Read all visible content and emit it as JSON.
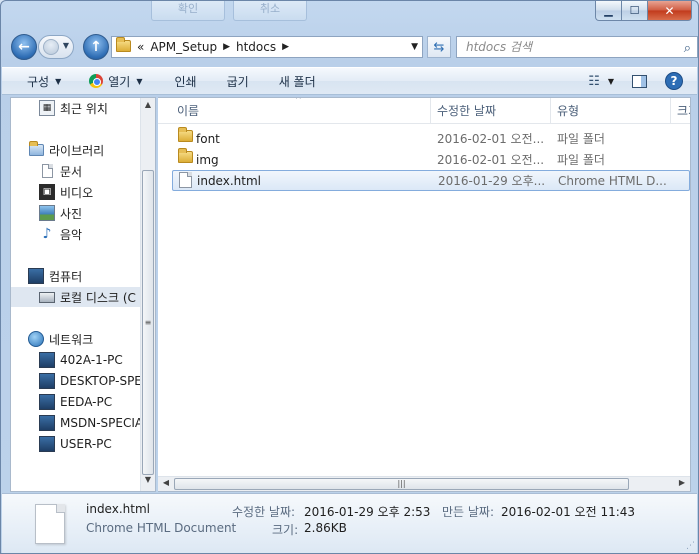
{
  "background_dialog": {
    "ok_label": "확인",
    "cancel_label": "취소"
  },
  "address_bar": {
    "overflow": "«",
    "crumbs": [
      "APM_Setup",
      "htdocs"
    ]
  },
  "search": {
    "placeholder": "htdocs 검색"
  },
  "toolbar": {
    "organize": "구성",
    "open": "열기",
    "print": "인쇄",
    "burn": "굽기",
    "new_folder": "새 폴더"
  },
  "nav_pane": {
    "recent": "최근 위치",
    "libraries": "라이브러리",
    "documents": "문서",
    "videos": "비디오",
    "pictures": "사진",
    "music": "음악",
    "computer": "컴퓨터",
    "local_disk": "로컬 디스크 (C",
    "network": "네트워크",
    "network_pcs": [
      "402A-1-PC",
      "DESKTOP-SPEC",
      "EEDA-PC",
      "MSDN-SPECIA",
      "USER-PC"
    ]
  },
  "columns": {
    "name": "이름",
    "modified": "수정한 날짜",
    "type": "유형",
    "size": "크기"
  },
  "files": [
    {
      "name": "font",
      "modified": "2016-02-01 오전...",
      "type": "파일 폴더",
      "icon": "folder-icon"
    },
    {
      "name": "img",
      "modified": "2016-02-01 오전...",
      "type": "파일 폴더",
      "icon": "folder-icon"
    },
    {
      "name": "index.html",
      "modified": "2016-01-29 오후...",
      "type": "Chrome HTML D...",
      "icon": "document-icon"
    }
  ],
  "details": {
    "file_name": "index.html",
    "file_type": "Chrome HTML Document",
    "modified_label": "수정한 날짜:",
    "modified_value": "2016-01-29 오후 2:53",
    "created_label": "만든 날짜:",
    "created_value": "2016-02-01 오전 11:43",
    "size_label": "크기:",
    "size_value": "2.86KB"
  }
}
